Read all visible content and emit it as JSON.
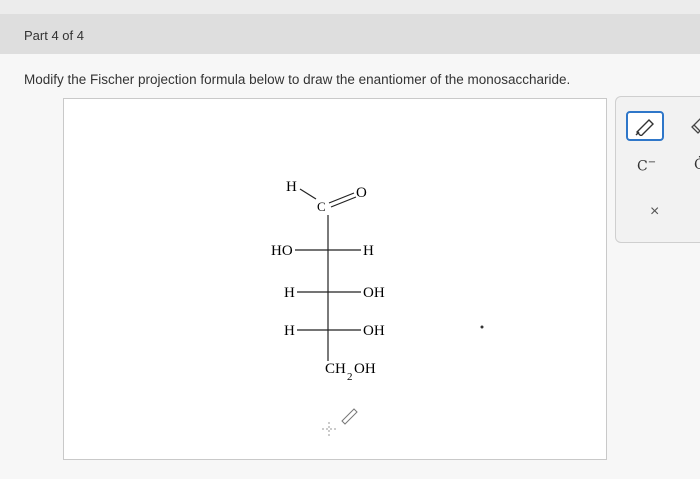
{
  "header": {
    "part": "Part 4 of 4"
  },
  "prompt": "Modify the Fischer projection formula below to draw the enantiomer of the monosaccharide.",
  "structure": {
    "top_h": "H",
    "carbonyl_c": "C",
    "carbonyl_o": "O",
    "rows": [
      {
        "left": "HO",
        "right": "H"
      },
      {
        "left": "H",
        "right": "OH"
      },
      {
        "left": "H",
        "right": "OH"
      }
    ],
    "bottom_main": "CH",
    "bottom_sub": "2",
    "bottom_tail": "OH"
  },
  "toolbar": {
    "atom1": "C",
    "atom1_sup": "−",
    "atom2": "Ċ",
    "close": "×"
  },
  "colors": {
    "accent": "#2f77c9",
    "header_bg": "#dedede"
  }
}
